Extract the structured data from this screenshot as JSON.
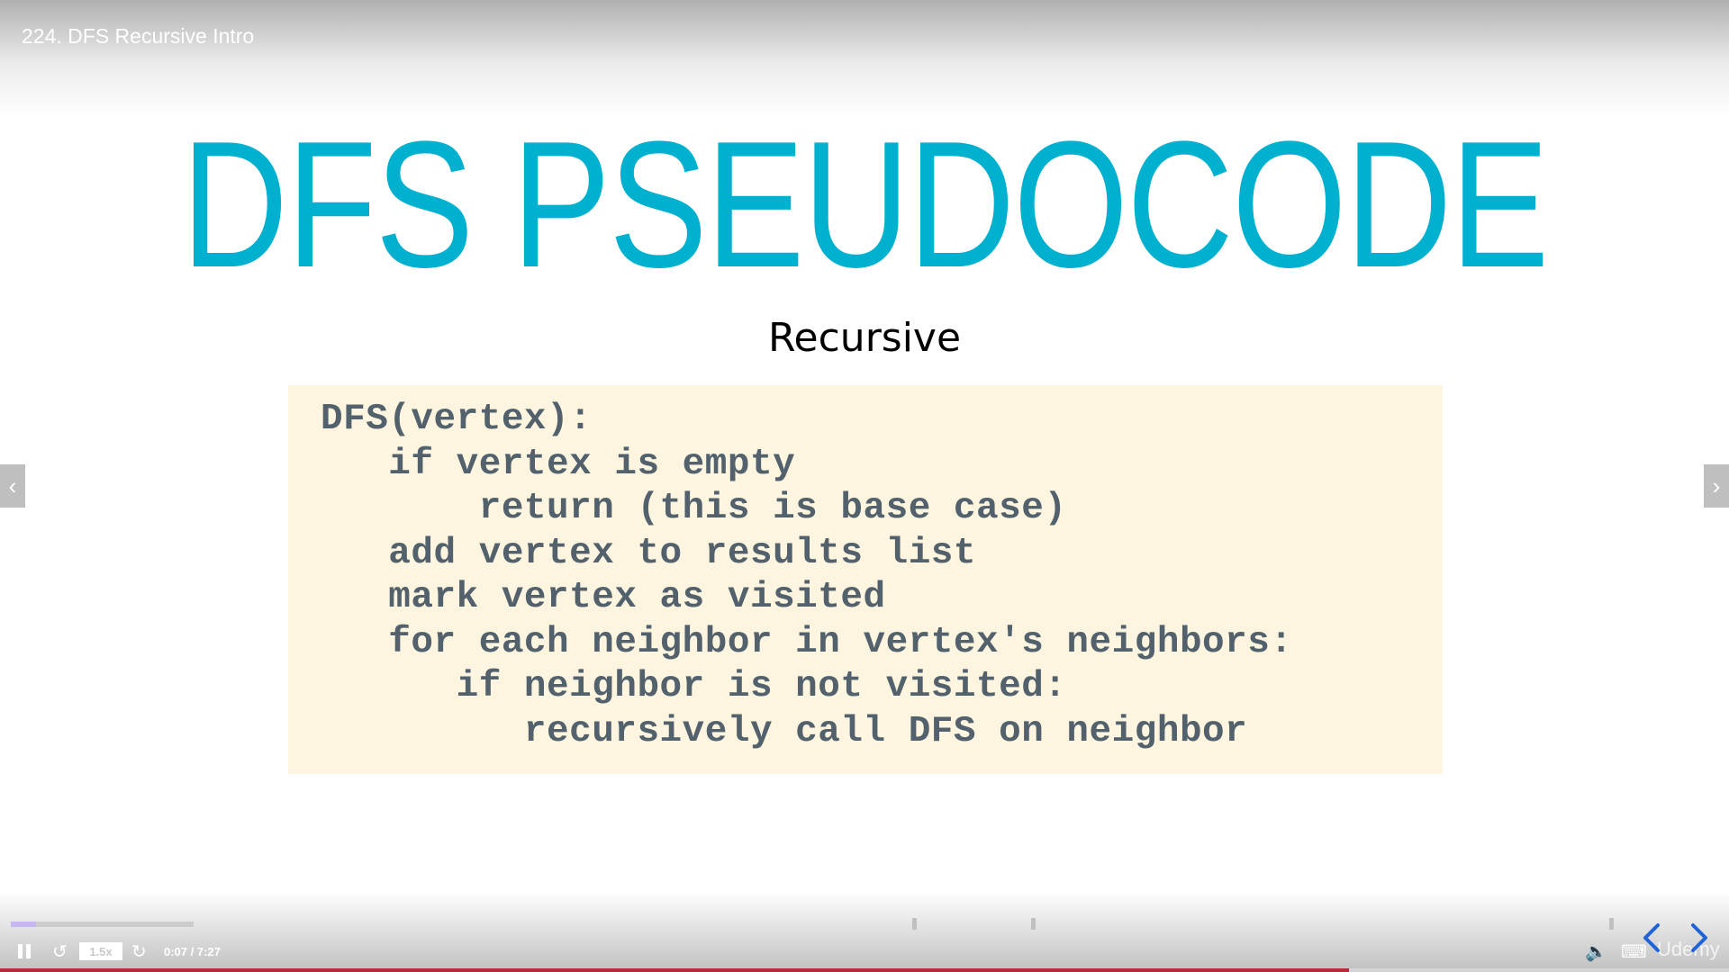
{
  "player": {
    "lecture_title": "224. DFS Recursive Intro",
    "speed": "1.5x",
    "time": "0:07 / 7:27",
    "progress_fraction": 0.78,
    "chapter_fraction": 0.14,
    "watermark": "Udemy",
    "colors": {
      "progress": "#b32d3a",
      "chapter": "#c7b6f0"
    },
    "icons": {
      "pause": "pause-icon",
      "rewind": "rewind-icon",
      "forward": "forward-icon",
      "volume": "volume-icon",
      "captions": "captions-icon",
      "prev": "chevron-left-icon",
      "next": "chevron-right-icon"
    }
  },
  "slide": {
    "title": "DFS PSEUDOCODE",
    "subtitle": "Recursive",
    "colors": {
      "title": "#00b0cf",
      "code_bg": "#fdf5e0",
      "code_text": "#52616b"
    },
    "code_lines": [
      "DFS(vertex):",
      "   if vertex is empty",
      "       return (this is base case)",
      "   add vertex to results list",
      "   mark vertex as visited",
      "   for each neighbor in vertex's neighbors:",
      "      if neighbor is not visited:",
      "         recursively call DFS on neighbor"
    ]
  }
}
